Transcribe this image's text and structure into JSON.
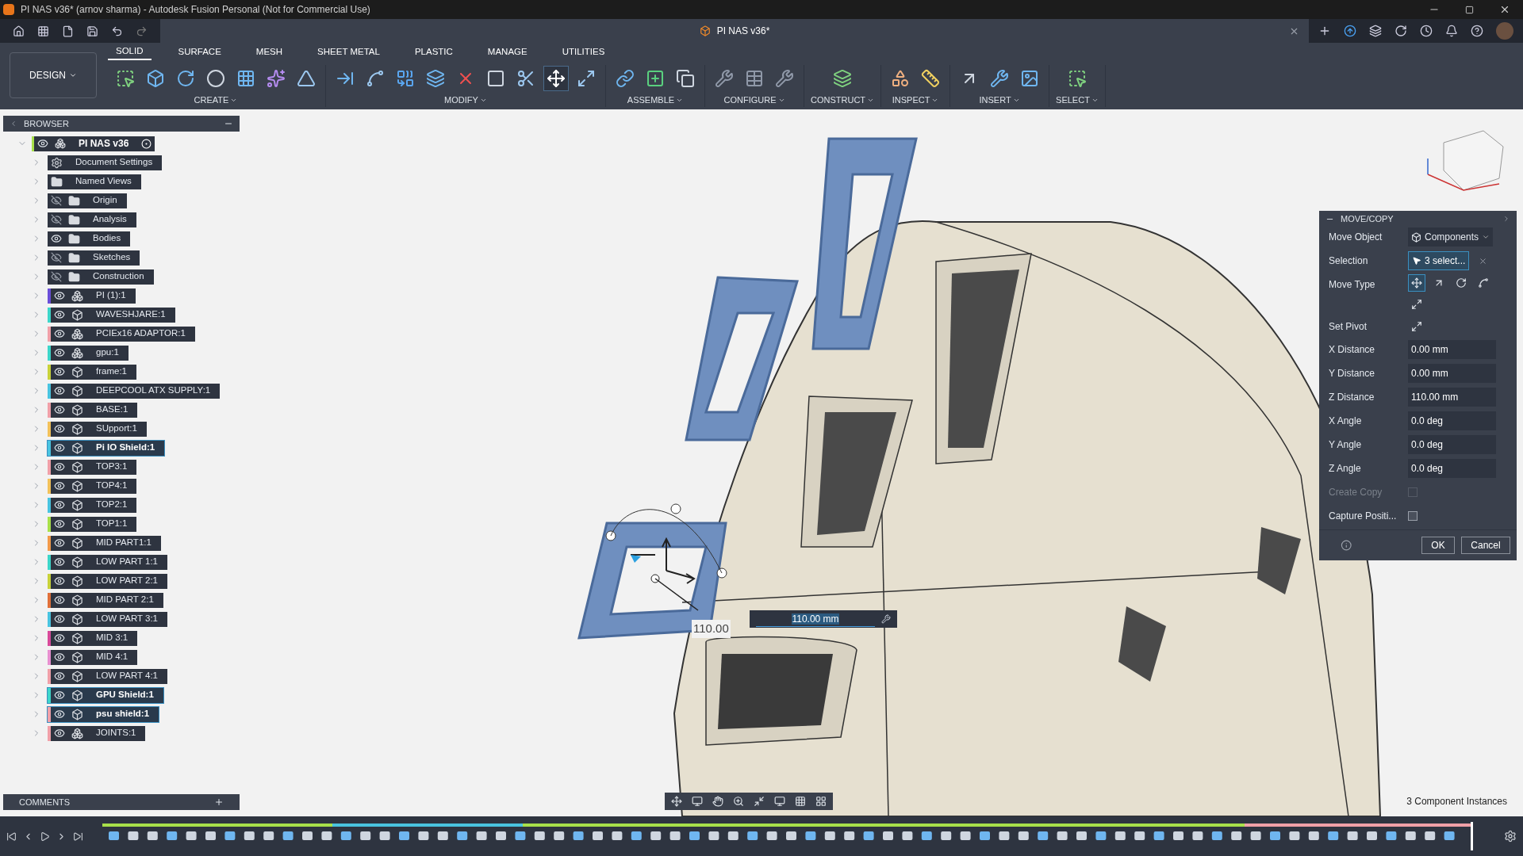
{
  "window": {
    "title": "PI NAS v36* (arnov sharma) - Autodesk Fusion Personal (Not for Commercial Use)"
  },
  "document_tab": {
    "label": "PI NAS v36*"
  },
  "toolbar": {
    "workspace": "DESIGN",
    "tabs": [
      {
        "label": "SOLID",
        "selected": true
      },
      {
        "label": "SURFACE",
        "selected": false
      },
      {
        "label": "MESH",
        "selected": false
      },
      {
        "label": "SHEET METAL",
        "selected": false
      },
      {
        "label": "PLASTIC",
        "selected": false
      },
      {
        "label": "MANAGE",
        "selected": false
      },
      {
        "label": "UTILITIES",
        "selected": false
      }
    ],
    "groups": [
      {
        "label": "CREATE",
        "tools": [
          {
            "kind": "sketch",
            "selected": false
          },
          {
            "kind": "extrude",
            "selected": false
          },
          {
            "kind": "revolve",
            "selected": false
          },
          {
            "kind": "hole",
            "selected": false
          },
          {
            "kind": "pattern",
            "selected": false
          },
          {
            "kind": "form",
            "selected": false
          },
          {
            "kind": "mirror",
            "selected": false
          }
        ]
      },
      {
        "label": "MODIFY",
        "tools": [
          {
            "kind": "presspull",
            "selected": false
          },
          {
            "kind": "fillet",
            "selected": false
          },
          {
            "kind": "combine",
            "selected": false
          },
          {
            "kind": "shell",
            "selected": false
          },
          {
            "kind": "delete",
            "selected": false
          },
          {
            "kind": "chamfer",
            "selected": false
          },
          {
            "kind": "split",
            "selected": false
          },
          {
            "kind": "move",
            "selected": true
          },
          {
            "kind": "scale",
            "selected": false
          }
        ]
      },
      {
        "label": "ASSEMBLE",
        "tools": [
          {
            "kind": "link",
            "selected": false
          },
          {
            "kind": "newcomponent",
            "selected": false
          },
          {
            "kind": "joint",
            "selected": false
          }
        ]
      },
      {
        "label": "CONFIGURE",
        "tools": [
          {
            "kind": "config",
            "selected": false
          },
          {
            "kind": "table",
            "selected": false
          },
          {
            "kind": "config",
            "selected": false
          }
        ]
      },
      {
        "label": "CONSTRUCT",
        "tools": [
          {
            "kind": "plane",
            "selected": false
          }
        ]
      },
      {
        "label": "INSPECT",
        "tools": [
          {
            "kind": "shapes",
            "selected": false
          },
          {
            "kind": "measure",
            "selected": false
          }
        ]
      },
      {
        "label": "INSERT",
        "tools": [
          {
            "kind": "insert",
            "selected": false
          },
          {
            "kind": "fastener",
            "selected": false
          },
          {
            "kind": "canvas",
            "selected": false
          }
        ]
      },
      {
        "label": "SELECT",
        "tools": [
          {
            "kind": "select",
            "selected": false
          }
        ]
      }
    ]
  },
  "browser": {
    "title": "BROWSER",
    "root": {
      "label": "PI NAS v36",
      "expanded": true,
      "color": "#a8e04a"
    },
    "items": [
      {
        "label": "Document Settings",
        "kind": "settings",
        "selected": false
      },
      {
        "label": "Named Views",
        "kind": "views",
        "selected": false
      },
      {
        "label": "Origin",
        "kind": "folder",
        "visible": false,
        "selected": false
      },
      {
        "label": "Analysis",
        "kind": "folder",
        "visible": false,
        "selected": false
      },
      {
        "label": "Bodies",
        "kind": "folder",
        "visible": true,
        "selected": false
      },
      {
        "label": "Sketches",
        "kind": "folder",
        "visible": false,
        "selected": false
      },
      {
        "label": "Construction",
        "kind": "folder",
        "visible": false,
        "selected": false
      },
      {
        "label": "PI (1):1",
        "kind": "assembly",
        "visible": true,
        "selected": false,
        "color": "#6a4ed8"
      },
      {
        "label": "WAVESHJARE:1",
        "kind": "component",
        "visible": true,
        "selected": false,
        "color": "#3dd6c9"
      },
      {
        "label": "PCIEx16 ADAPTOR:1",
        "kind": "assembly",
        "visible": true,
        "selected": false,
        "color": "#f0a0a8"
      },
      {
        "label": "gpu:1",
        "kind": "assembly",
        "visible": true,
        "selected": false,
        "color": "#3dd6c9"
      },
      {
        "label": "frame:1",
        "kind": "component",
        "visible": true,
        "selected": false,
        "color": "#c8d23a"
      },
      {
        "label": "DEEPCOOL ATX SUPPLY:1",
        "kind": "component",
        "visible": true,
        "selected": false,
        "color": "#49c4e0"
      },
      {
        "label": "BASE:1",
        "kind": "component",
        "visible": true,
        "selected": false,
        "color": "#f0a0a8"
      },
      {
        "label": "SUpport:1",
        "kind": "component",
        "visible": true,
        "selected": false,
        "color": "#f2c15a"
      },
      {
        "label": "Pi IO Shield:1",
        "kind": "component",
        "visible": true,
        "selected": true,
        "color": "#49c4e0"
      },
      {
        "label": "TOP3:1",
        "kind": "component",
        "visible": true,
        "selected": false,
        "color": "#f0a0a8"
      },
      {
        "label": "TOP4:1",
        "kind": "component",
        "visible": true,
        "selected": false,
        "color": "#f2c15a"
      },
      {
        "label": "TOP2:1",
        "kind": "component",
        "visible": true,
        "selected": false,
        "color": "#49c4e0"
      },
      {
        "label": "TOP1:1",
        "kind": "component",
        "visible": true,
        "selected": false,
        "color": "#a8e04a"
      },
      {
        "label": "MID PART1:1",
        "kind": "component",
        "visible": true,
        "selected": false,
        "color": "#f29a4a"
      },
      {
        "label": "LOW PART 1:1",
        "kind": "component",
        "visible": true,
        "selected": false,
        "color": "#3dd6c9"
      },
      {
        "label": "LOW PART 2:1",
        "kind": "component",
        "visible": true,
        "selected": false,
        "color": "#c8d23a"
      },
      {
        "label": "MID PART 2:1",
        "kind": "component",
        "visible": true,
        "selected": false,
        "color": "#e0703a"
      },
      {
        "label": "LOW PART 3:1",
        "kind": "component",
        "visible": true,
        "selected": false,
        "color": "#49c4e0"
      },
      {
        "label": "MID 3:1",
        "kind": "component",
        "visible": true,
        "selected": false,
        "color": "#d84a9a"
      },
      {
        "label": "MID 4:1",
        "kind": "component",
        "visible": true,
        "selected": false,
        "color": "#e890d0"
      },
      {
        "label": "LOW PART 4:1",
        "kind": "component",
        "visible": true,
        "selected": false,
        "color": "#f0a0a8"
      },
      {
        "label": "GPU Shield:1",
        "kind": "component",
        "visible": true,
        "selected": true,
        "color": "#3dd6c9"
      },
      {
        "label": "psu shield:1",
        "kind": "component",
        "visible": true,
        "selected": true,
        "color": "#f0a0a8"
      },
      {
        "label": "JOINTS:1",
        "kind": "assembly",
        "visible": true,
        "selected": false,
        "color": "#f0a0a8"
      }
    ]
  },
  "viewport": {
    "dimension_label": "110.00",
    "dimension_input": "110.00 mm"
  },
  "move_copy": {
    "title": "MOVE/COPY",
    "move_object": {
      "label": "Move Object",
      "value": "Components"
    },
    "selection": {
      "label": "Selection",
      "value": "3 select..."
    },
    "move_type": {
      "label": "Move Type",
      "options": [
        {
          "kind": "free",
          "selected": true
        },
        {
          "kind": "translate",
          "selected": false
        },
        {
          "kind": "rotate",
          "selected": false
        },
        {
          "kind": "point",
          "selected": false
        },
        {
          "kind": "pointpoint",
          "selected": false
        }
      ]
    },
    "set_pivot": {
      "label": "Set Pivot"
    },
    "fields": [
      {
        "label": "X Distance",
        "value": "0.00 mm"
      },
      {
        "label": "Y Distance",
        "value": "0.00 mm"
      },
      {
        "label": "Z Distance",
        "value": "110.00 mm"
      },
      {
        "label": "X Angle",
        "value": "0.0 deg"
      },
      {
        "label": "Y Angle",
        "value": "0.0 deg"
      },
      {
        "label": "Z Angle",
        "value": "0.0 deg"
      }
    ],
    "checkboxes": [
      {
        "label": "Create Copy",
        "checked": false,
        "disabled": true
      },
      {
        "label": "Capture Positi...",
        "checked": false,
        "disabled": false
      }
    ],
    "buttons": [
      "OK",
      "Cancel"
    ]
  },
  "comments": {
    "title": "COMMENTS"
  },
  "status": "3 Component Instances"
}
